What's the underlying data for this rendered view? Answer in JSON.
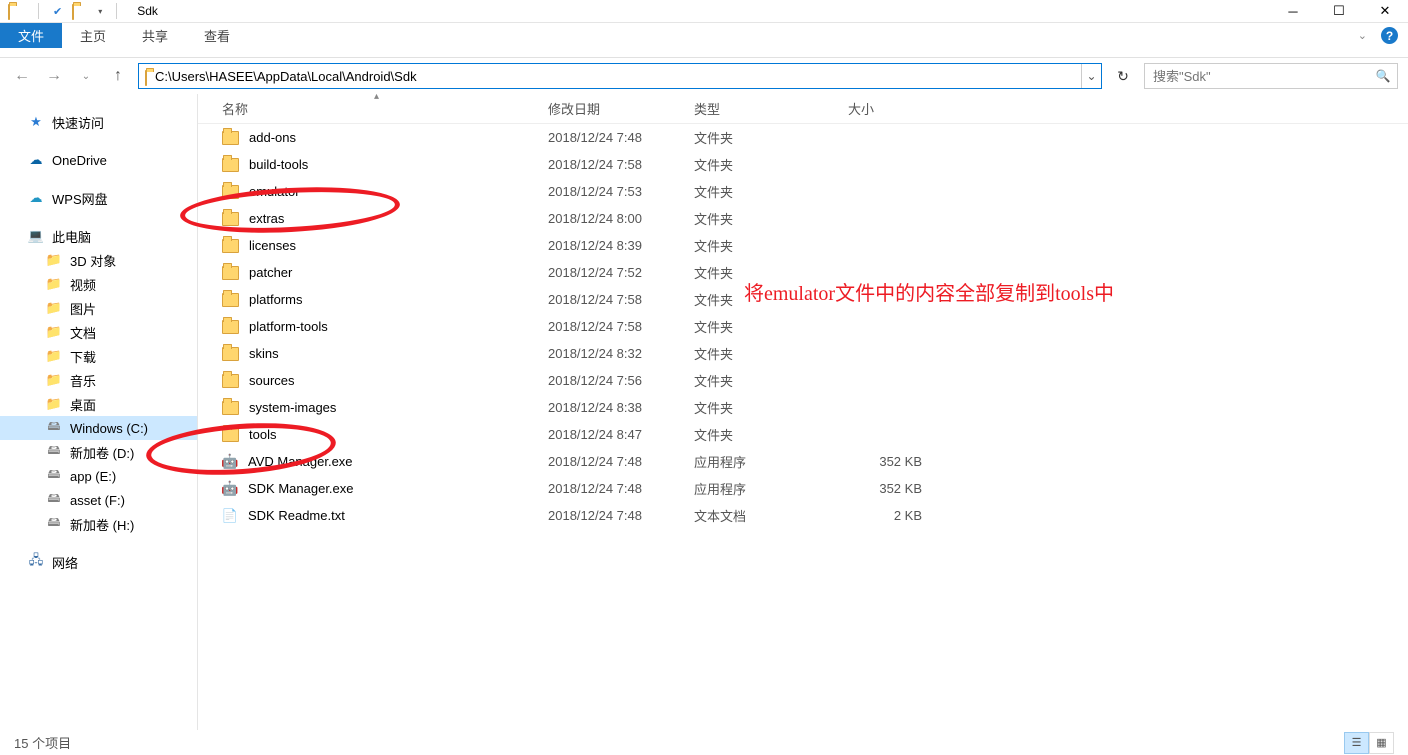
{
  "titlebar": {
    "title": "Sdk"
  },
  "ribbon": {
    "file": "文件",
    "home": "主页",
    "share": "共享",
    "view": "查看"
  },
  "nav": {
    "path": "C:\\Users\\HASEE\\AppData\\Local\\Android\\Sdk",
    "search_placeholder": "搜索\"Sdk\""
  },
  "sidebar": {
    "quick": "快速访问",
    "onedrive": "OneDrive",
    "wps": "WPS网盘",
    "thispc": "此电脑",
    "objs3d": "3D 对象",
    "videos": "视频",
    "pictures": "图片",
    "docs": "文档",
    "downloads": "下载",
    "music": "音乐",
    "desktop": "桌面",
    "winc": "Windows (C:)",
    "vold": "新加卷 (D:)",
    "appe": "app (E:)",
    "assetf": "asset (F:)",
    "volh": "新加卷 (H:)",
    "network": "网络"
  },
  "columns": {
    "name": "名称",
    "date": "修改日期",
    "type": "类型",
    "size": "大小"
  },
  "rows": [
    {
      "icon": "folder",
      "name": "add-ons",
      "date": "2018/12/24 7:48",
      "type": "文件夹",
      "size": ""
    },
    {
      "icon": "folder",
      "name": "build-tools",
      "date": "2018/12/24 7:58",
      "type": "文件夹",
      "size": ""
    },
    {
      "icon": "folder",
      "name": "emulator",
      "date": "2018/12/24 7:53",
      "type": "文件夹",
      "size": ""
    },
    {
      "icon": "folder",
      "name": "extras",
      "date": "2018/12/24 8:00",
      "type": "文件夹",
      "size": ""
    },
    {
      "icon": "folder",
      "name": "licenses",
      "date": "2018/12/24 8:39",
      "type": "文件夹",
      "size": ""
    },
    {
      "icon": "folder",
      "name": "patcher",
      "date": "2018/12/24 7:52",
      "type": "文件夹",
      "size": ""
    },
    {
      "icon": "folder",
      "name": "platforms",
      "date": "2018/12/24 7:58",
      "type": "文件夹",
      "size": ""
    },
    {
      "icon": "folder",
      "name": "platform-tools",
      "date": "2018/12/24 7:58",
      "type": "文件夹",
      "size": ""
    },
    {
      "icon": "folder",
      "name": "skins",
      "date": "2018/12/24 8:32",
      "type": "文件夹",
      "size": ""
    },
    {
      "icon": "folder",
      "name": "sources",
      "date": "2018/12/24 7:56",
      "type": "文件夹",
      "size": ""
    },
    {
      "icon": "folder",
      "name": "system-images",
      "date": "2018/12/24 8:38",
      "type": "文件夹",
      "size": ""
    },
    {
      "icon": "folder",
      "name": "tools",
      "date": "2018/12/24 8:47",
      "type": "文件夹",
      "size": ""
    },
    {
      "icon": "exe",
      "name": "AVD Manager.exe",
      "date": "2018/12/24 7:48",
      "type": "应用程序",
      "size": "352 KB"
    },
    {
      "icon": "exe",
      "name": "SDK Manager.exe",
      "date": "2018/12/24 7:48",
      "type": "应用程序",
      "size": "352 KB"
    },
    {
      "icon": "txt",
      "name": "SDK Readme.txt",
      "date": "2018/12/24 7:48",
      "type": "文本文档",
      "size": "2 KB"
    }
  ],
  "status": {
    "count": "15 个项目"
  },
  "annotation": {
    "text": "将emulator文件中的内容全部复制到tools中"
  }
}
